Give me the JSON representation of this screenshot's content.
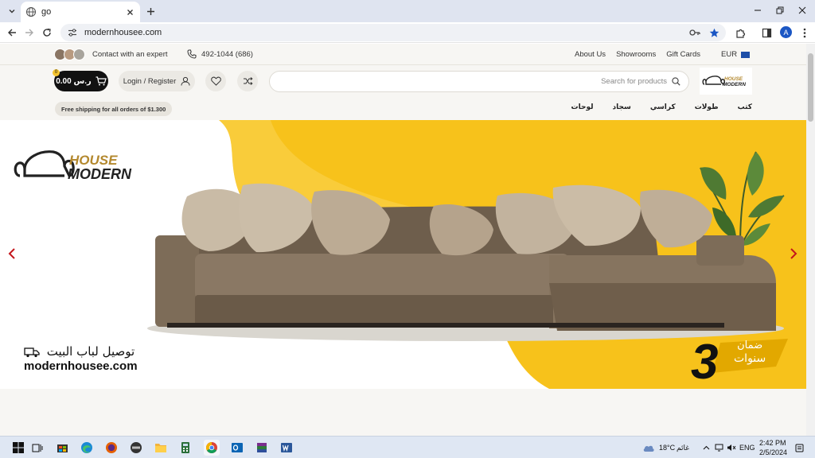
{
  "browser": {
    "tab_title": "go",
    "url": "modernhousee.com"
  },
  "topbar": {
    "expert_label": "Contact with an expert",
    "phone": "492-1044 (686)",
    "links": [
      "About Us",
      "Showrooms",
      "Gift Cards"
    ],
    "currency": "EUR"
  },
  "header": {
    "cart_amount": "0.00 ر.س",
    "cart_count": "0",
    "login_label": "Login / Register",
    "search_placeholder": "Search for products",
    "logo_top": "HOUSE",
    "logo_bottom": "MODERN"
  },
  "shipping_notice": "Free shipping for all orders of $1.300",
  "categories": [
    "كتب",
    "طولات",
    "كراسي",
    "سجاد",
    "لوحات"
  ],
  "hero": {
    "brand_top": "HOUSE",
    "brand_bottom": "MODERN",
    "delivery_text": "توصيل لباب البيت",
    "site_url": "modernhousee.com",
    "warranty_number": "3",
    "warranty_line1": "ضمان",
    "warranty_line2": "سنوات"
  },
  "taskbar": {
    "weather": "18°C",
    "weather_label": "غائم",
    "language": "ENG",
    "time": "2:42 PM",
    "date": "2/5/2024"
  },
  "colors": {
    "accent_yellow": "#f7c21b",
    "sofa": "#7d6c58",
    "cart_button": "#111111",
    "arrow_red": "#c4161c"
  }
}
